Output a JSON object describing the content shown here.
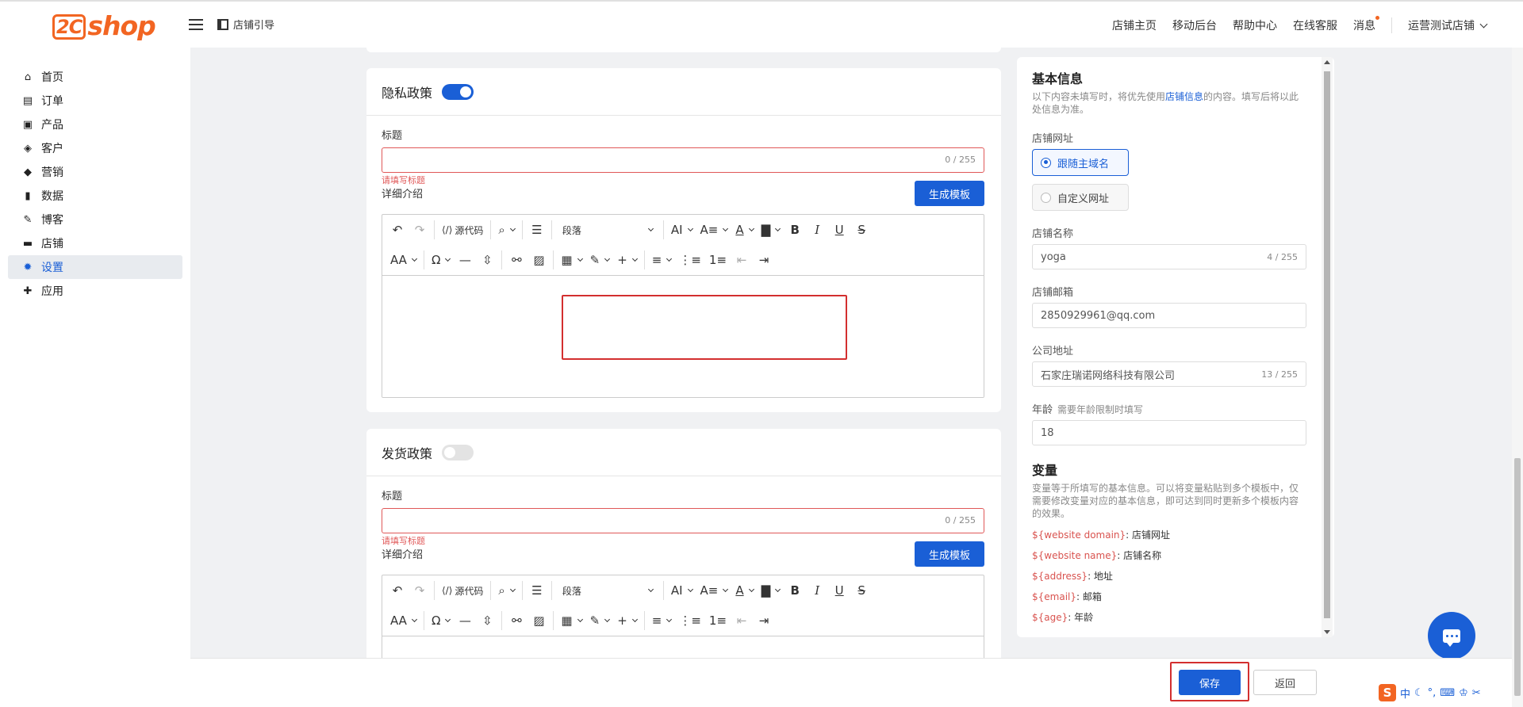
{
  "brand": {
    "logo_box": "2C",
    "logo_text": "shop"
  },
  "header": {
    "guide_label": "店铺引导",
    "nav": [
      "店铺主页",
      "移动后台",
      "帮助中心",
      "在线客服",
      "消息"
    ],
    "store_name": "运营测试店铺"
  },
  "sidebar": {
    "items": [
      {
        "label": "首页",
        "icon": "⌂"
      },
      {
        "label": "订单",
        "icon": "▤"
      },
      {
        "label": "产品",
        "icon": "▣"
      },
      {
        "label": "客户",
        "icon": "◈"
      },
      {
        "label": "营销",
        "icon": "◆"
      },
      {
        "label": "数据",
        "icon": "▮"
      },
      {
        "label": "博客",
        "icon": "✎"
      },
      {
        "label": "店铺",
        "icon": "▬"
      },
      {
        "label": "设置",
        "icon": "✹"
      },
      {
        "label": "应用",
        "icon": "✚"
      }
    ],
    "active": "设置"
  },
  "privacy": {
    "title": "隐私政策",
    "enabled": true,
    "field_title_label": "标题",
    "title_count": "0 / 255",
    "error": "请填写标题",
    "detail_label": "详细介绍",
    "gen_button": "生成模板"
  },
  "shipping": {
    "title": "发货政策",
    "enabled": false,
    "field_title_label": "标题",
    "title_count": "0 / 255",
    "error": "请填写标题",
    "detail_label": "详细介绍",
    "gen_button": "生成模板"
  },
  "editor_toolbar": {
    "source_label": "源代码",
    "block_label": "段落"
  },
  "basic_info": {
    "title": "基本信息",
    "desc_prefix": "以下内容未填写时，将优先使用",
    "desc_link": "店铺信息",
    "desc_suffix": "的内容。填写后将以此处信息为准。",
    "url_label": "店铺网址",
    "url_options": [
      "跟随主域名",
      "自定义网址"
    ],
    "url_selected": "跟随主域名",
    "name_label": "店铺名称",
    "name_value": "yoga",
    "name_count": "4 / 255",
    "email_label": "店铺邮箱",
    "email_value": "2850929961@qq.com",
    "address_label": "公司地址",
    "address_value": "石家庄瑞诺网络科技有限公司",
    "address_count": "13 / 255",
    "age_label": "年龄",
    "age_hint": "需要年龄限制时填写",
    "age_value": "18"
  },
  "variables": {
    "title": "变量",
    "desc": "变量等于所填写的基本信息。可以将变量粘贴到多个模板中，仅需要修改变量对应的基本信息，即可达到同时更新多个模板内容的效果。",
    "items": [
      {
        "key": "${website domain}",
        "value": ": 店铺网址"
      },
      {
        "key": "${website name}",
        "value": ": 店铺名称"
      },
      {
        "key": "${address}",
        "value": ": 地址"
      },
      {
        "key": "${email}",
        "value": ": 邮箱"
      },
      {
        "key": "${age}",
        "value": ": 年龄"
      }
    ]
  },
  "footer": {
    "save": "保存",
    "back": "返回"
  },
  "ime": {
    "logo": "S",
    "lang": "中"
  },
  "colors": {
    "accent": "#1a5fd6",
    "brand": "#f26522",
    "error": "#e05858",
    "annotation": "#d32f2f"
  }
}
